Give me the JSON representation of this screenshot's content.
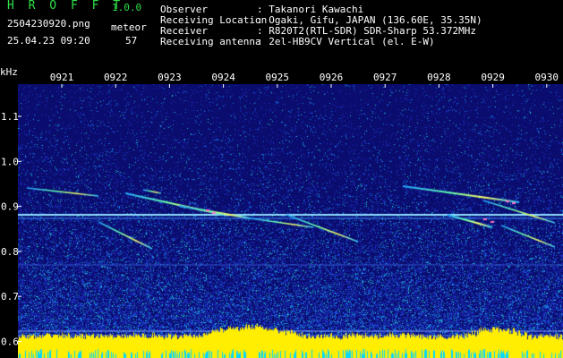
{
  "header": {
    "app_title": "H R O F F T",
    "app_version": "1.0.0",
    "file_name": "2504230920.png",
    "meteor_label": "meteor",
    "date_time": "25.04.23 09:20",
    "meteor_count": "57"
  },
  "info": [
    {
      "label": "Observer",
      "value": ": Takanori Kawachi"
    },
    {
      "label": "Receiving Location",
      "value": ": Ogaki, Gifu, JAPAN (136.60E, 35.35N)"
    },
    {
      "label": "Receiver",
      "value": ": R820T2(RTL-SDR) SDR-Sharp 53.372MHz"
    },
    {
      "label": "Receiving antenna",
      "value": ": 2el-HB9CV Vertical (el. E-W)"
    }
  ],
  "axis": {
    "y_unit": "kHz",
    "y_ticks": [
      "1.1",
      "1.0",
      "0.9",
      "0.8",
      "0.7",
      "0.6"
    ],
    "x_ticks": [
      "0921",
      "0922",
      "0923",
      "0924",
      "0925",
      "0926",
      "0927",
      "0928",
      "0929",
      "0930"
    ]
  },
  "colors": {
    "background": "#000000",
    "spectrogram_base": "#0a0c6e",
    "title_green": "#2ee04a",
    "carrier_line": "#8fe0ff",
    "noise_floor": "#ffee00",
    "noise_floor_alt": "#00d8ff"
  }
}
